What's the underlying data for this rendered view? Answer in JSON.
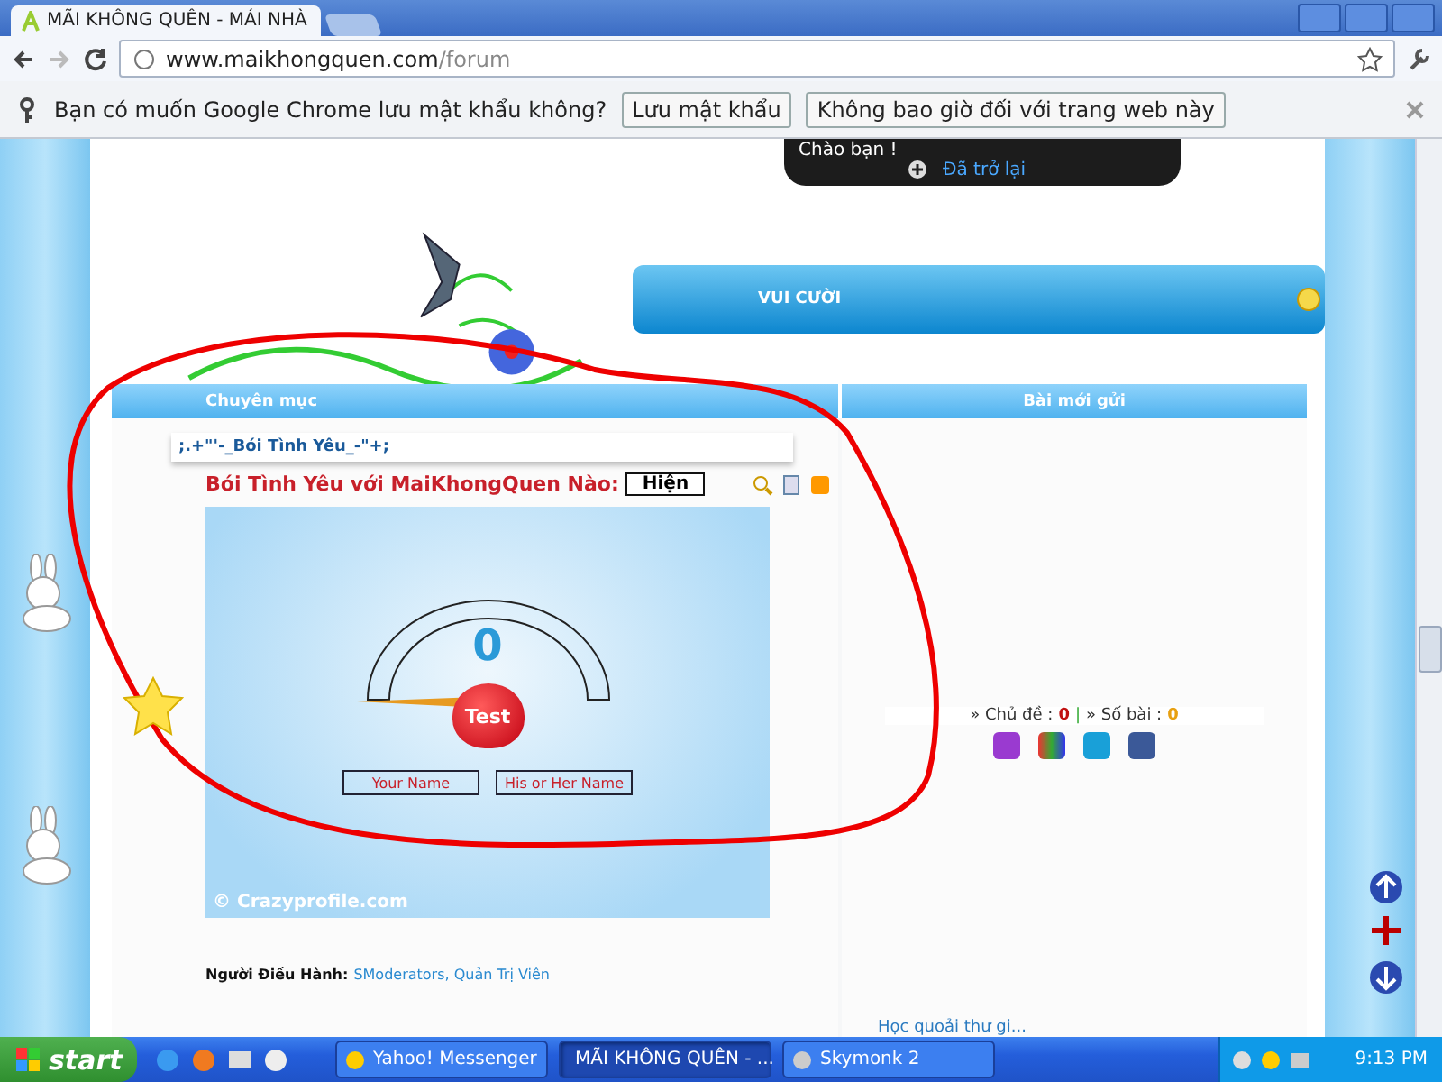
{
  "browser": {
    "tab_title": "MÃI KHÔNG QUÊN - MÁI NHÀ",
    "url_host": "www.maikhongquen.com",
    "url_path": "/forum"
  },
  "password_bar": {
    "message": "Bạn có muốn Google Chrome lưu mật khẩu không?",
    "buttons": [
      "Lưu mật khẩu",
      "Không bao giờ đối với trang web này"
    ]
  },
  "user_panel": {
    "greeting": "Chào bạn !",
    "link": "Đã trở lại"
  },
  "banner": {
    "title": "VUI CƯỜI"
  },
  "table": {
    "columns": [
      "Chuyên mục",
      "Bài mới gửi"
    ]
  },
  "forum": {
    "category": ";.+\"'-_Bói Tình Yêu_-\"+;",
    "heading": "Bói Tình Yêu với MaiKhongQuen Nào:",
    "toggle": "Hiện",
    "game": {
      "score": "0",
      "button": "Test",
      "fields": [
        "Your Name",
        "His or Her Name"
      ],
      "credit": "© Crazyprofile.com"
    },
    "moderators_label": "Người Điều Hành:",
    "moderators": "SModerators, Quản Trị Viên"
  },
  "stats": {
    "topics_label": "» Chủ đề :",
    "topics": "0",
    "separator": "|",
    "posts_label": "» Số bài :",
    "posts": "0"
  },
  "next_forum": {
    "link": "Học quoải thư gi..."
  },
  "taskbar": {
    "start": "start",
    "tasks": [
      {
        "label": "Yahoo! Messenger",
        "selected": false
      },
      {
        "label": "MÃI KHÔNG QUÊN - ...",
        "selected": true
      },
      {
        "label": "Skymonk 2",
        "selected": false
      }
    ],
    "clock": "9:13 PM"
  }
}
